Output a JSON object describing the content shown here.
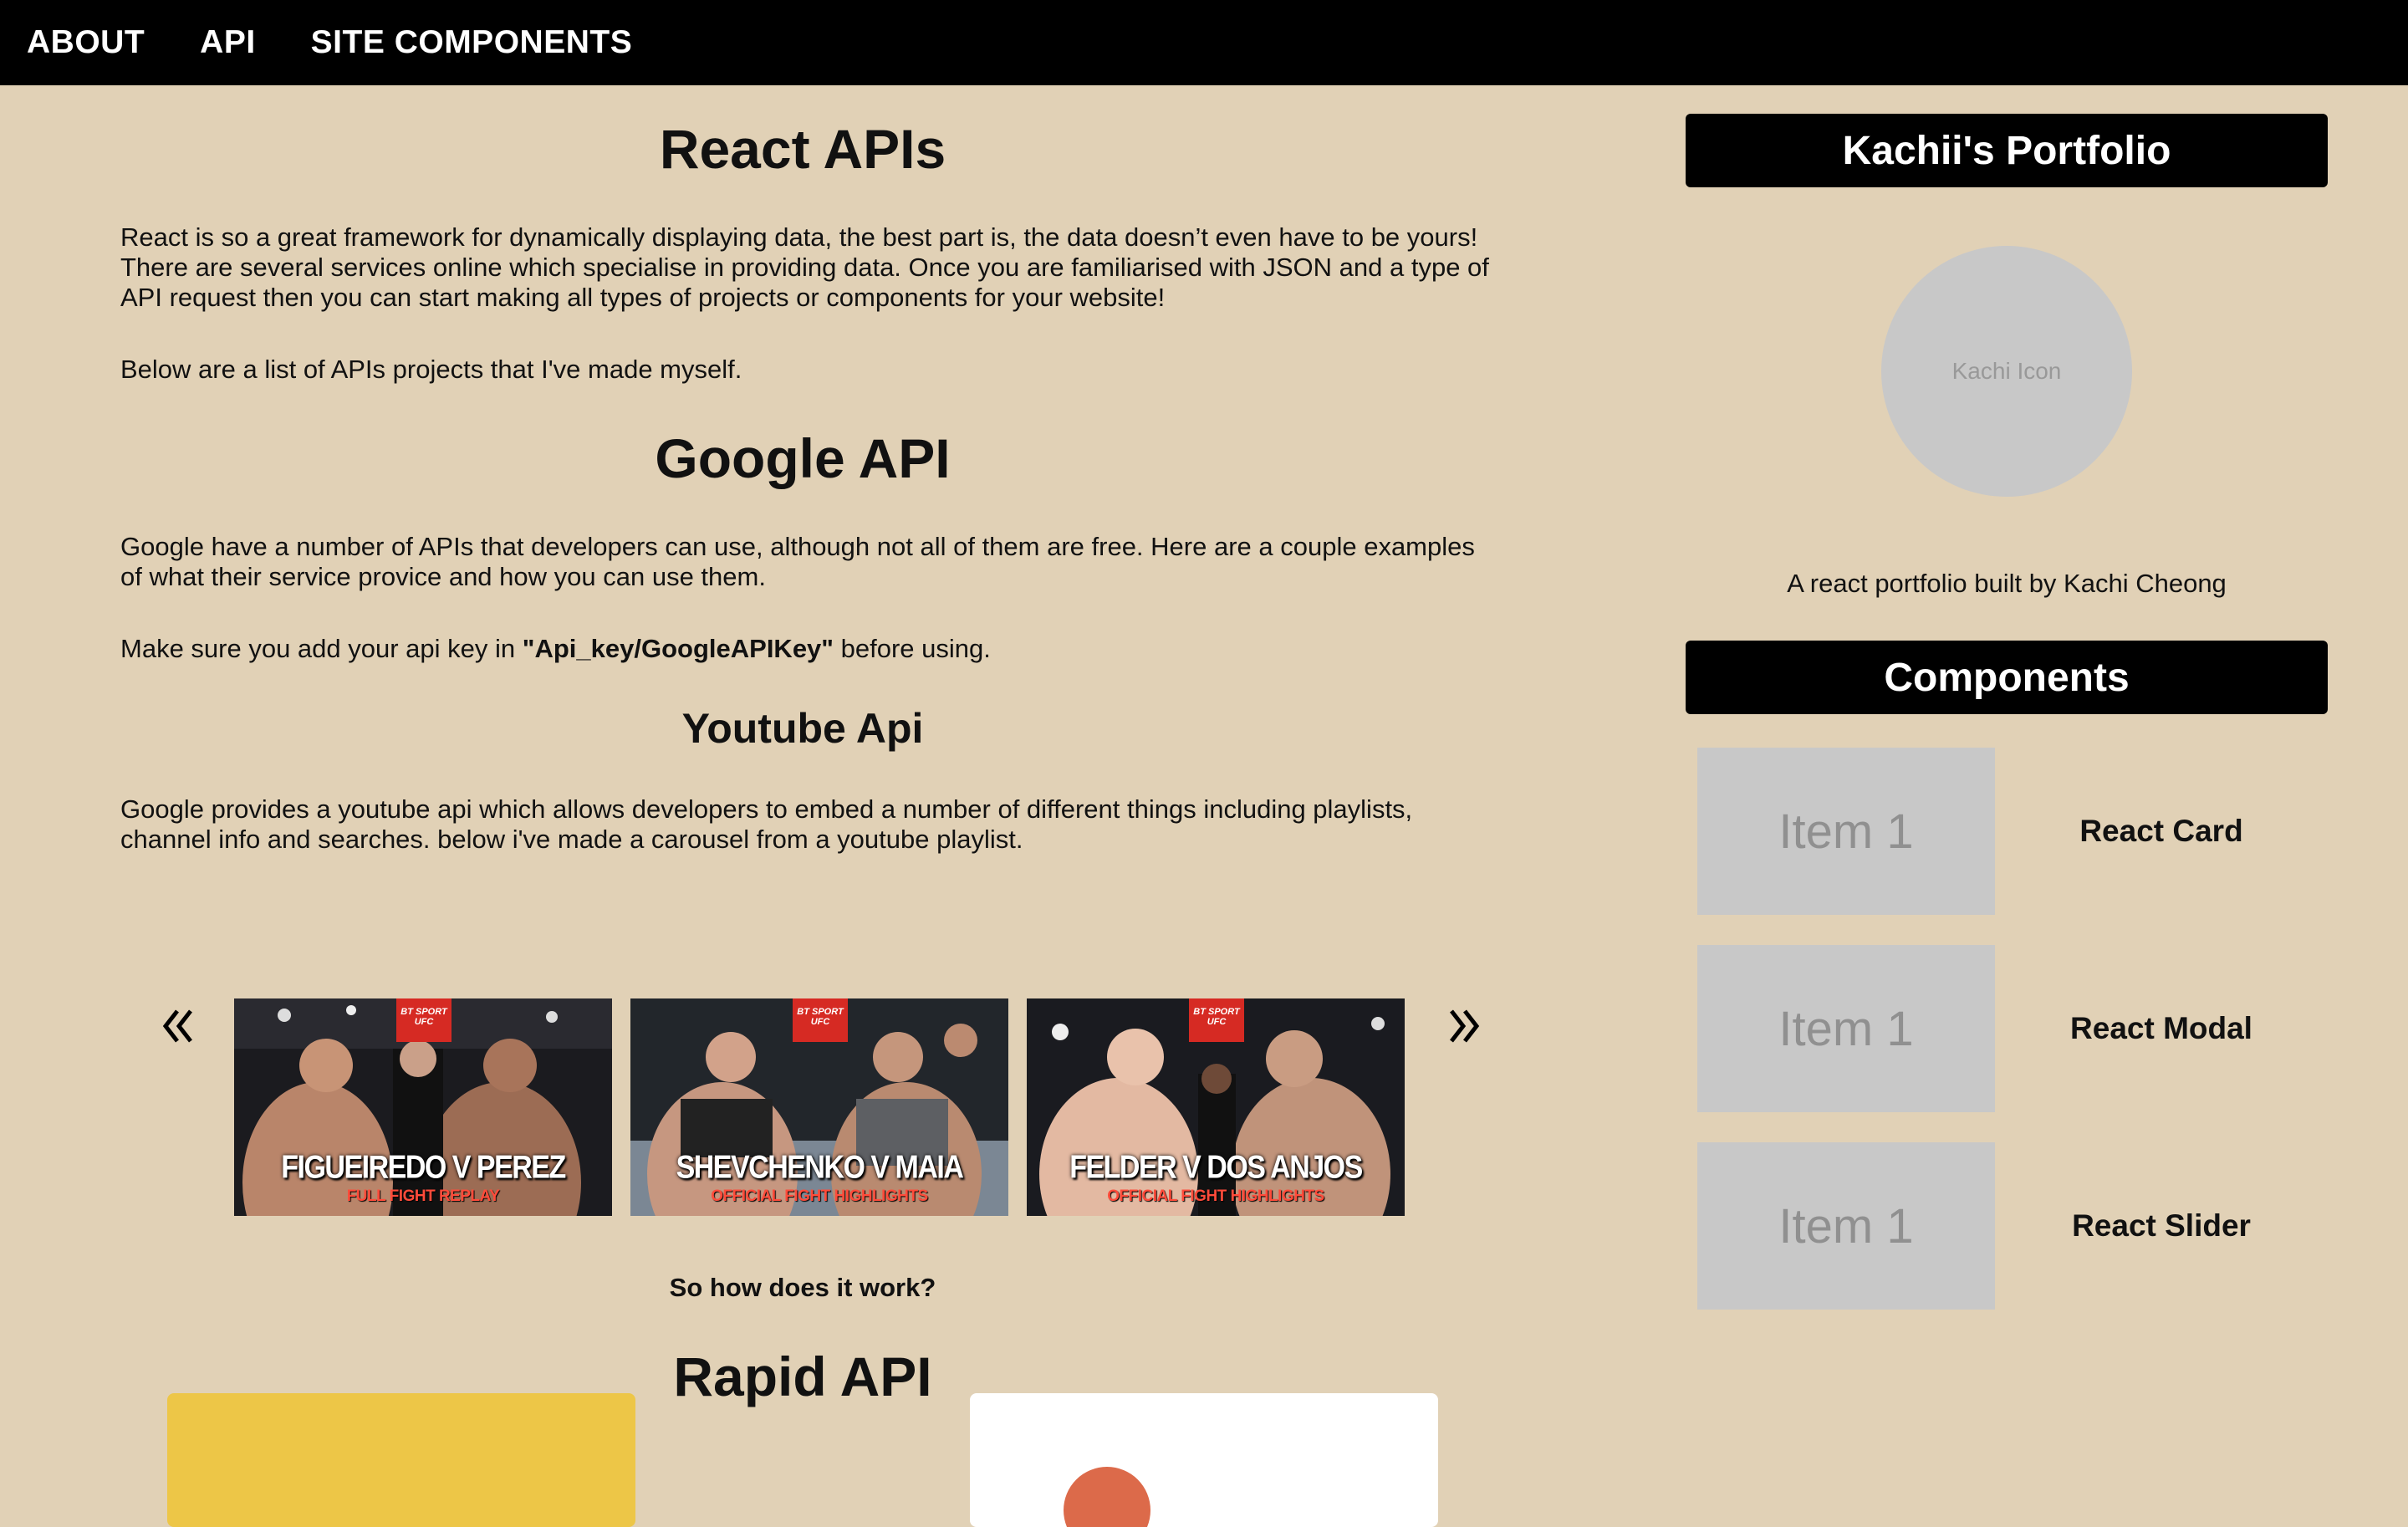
{
  "nav": {
    "items": [
      {
        "label": "ABOUT"
      },
      {
        "label": "API"
      },
      {
        "label": "SITE COMPONENTS"
      }
    ]
  },
  "main": {
    "title": "React APIs",
    "intro": "React is so a great framework for dynamically displaying data, the best part is, the data doesn’t even have to be yours! There are several services online which specialise in providing data. Once you are familiarised with JSON and a type of API request then you can start making all types of projects or components for your website!",
    "list_intro": "Below are a list of APIs projects that I've made myself.",
    "google": {
      "title": "Google API",
      "desc": "Google have a number of APIs that developers can use, although not all of them are free. Here are a couple examples of what their service provice and how you can use them.",
      "key_note_prefix": "Make sure you add your api key in ",
      "key_note_path": "\"Api_key/GoogleAPIKey\"",
      "key_note_suffix": " before using."
    },
    "youtube": {
      "title": "Youtube Api",
      "desc": "Google provides a youtube api which allows developers to embed a number of different things including playlists, channel info and searches. below i've made a carousel from a youtube playlist.",
      "videos": [
        {
          "title": "FIGUEIREDO V PEREZ",
          "subtitle": "FULL FIGHT REPLAY",
          "badge_top": "BT SPORT",
          "badge_bottom": "UFC"
        },
        {
          "title": "SHEVCHENKO V MAIA",
          "subtitle": "OFFICIAL FIGHT HIGHLIGHTS",
          "badge_top": "BT SPORT",
          "badge_bottom": "UFC"
        },
        {
          "title": "FELDER V DOS ANJOS",
          "subtitle": "OFFICIAL FIGHT HIGHLIGHTS",
          "badge_top": "BT SPORT",
          "badge_bottom": "UFC"
        }
      ]
    },
    "how_it_works": "So how does it work?",
    "rapid": {
      "title": "Rapid API"
    }
  },
  "sidebar": {
    "portfolio_title": "Kachii's Portfolio",
    "avatar_text": "Kachi Icon",
    "caption": "A react portfolio built by Kachi Cheong",
    "components_title": "Components",
    "components": [
      {
        "thumb": "Item 1",
        "label": "React Card"
      },
      {
        "thumb": "Item 1",
        "label": "React Modal"
      },
      {
        "thumb": "Item 1",
        "label": "React Slider"
      }
    ]
  },
  "colors": {
    "background": "#e1d1b6",
    "nav": "#000000",
    "placeholder": "#c8c8c8",
    "rapid_card_yellow": "#edc647",
    "rapid_card_white": "#ffffff",
    "accent_orange": "#dc6a4a"
  },
  "icons": {
    "prev": "chevron-double-left-icon",
    "next": "chevron-double-right-icon"
  }
}
